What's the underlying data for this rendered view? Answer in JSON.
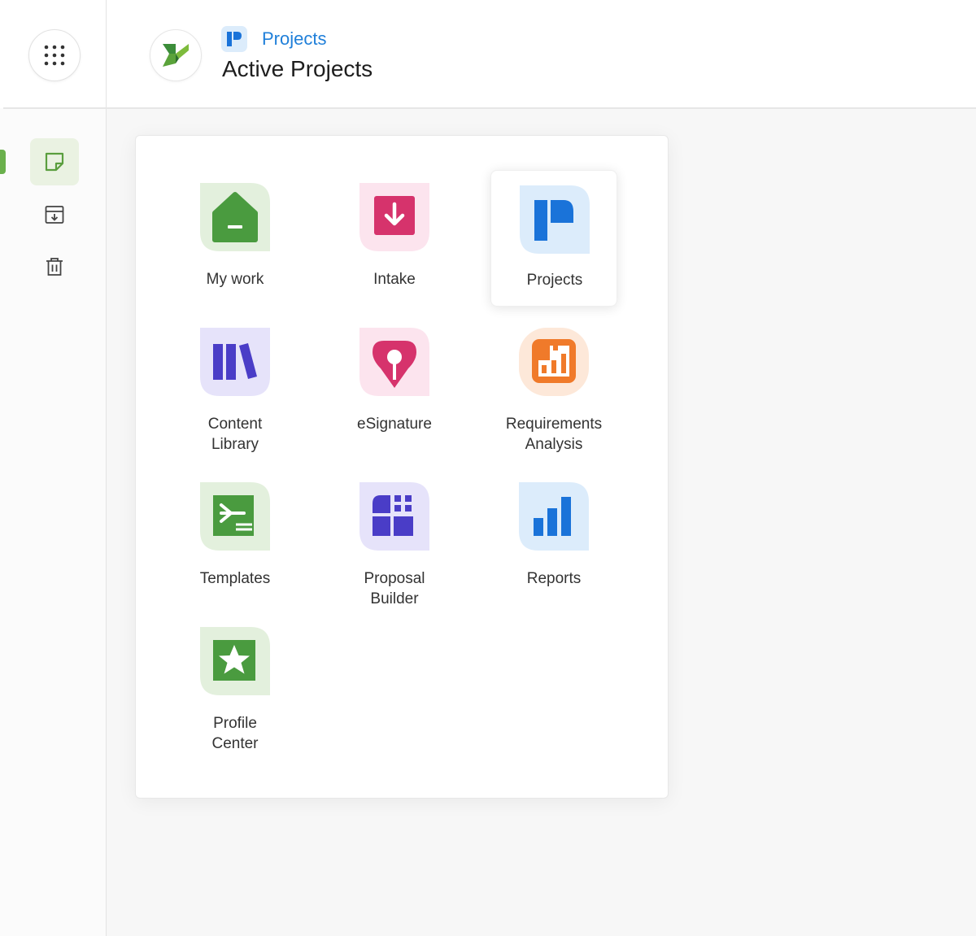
{
  "header": {
    "breadcrumb": "Projects",
    "title": "Active Projects"
  },
  "sidebar": {
    "items": [
      {
        "name": "notes",
        "icon": "note-icon",
        "active": true
      },
      {
        "name": "archive",
        "icon": "archive-download-icon",
        "active": false
      },
      {
        "name": "trash",
        "icon": "trash-icon",
        "active": false
      }
    ]
  },
  "app_launcher": {
    "apps": [
      {
        "label": "My work",
        "icon": "home-icon",
        "color": "#4a9b3f",
        "bg": "#e3f0dd",
        "selected": false
      },
      {
        "label": "Intake",
        "icon": "inbox-download-icon",
        "color": "#d6336c",
        "bg": "#fce4ee",
        "selected": false
      },
      {
        "label": "Projects",
        "icon": "projects-logo-icon",
        "color": "#1a73d9",
        "bg": "#dcecfb",
        "selected": true
      },
      {
        "label": "Content\nLibrary",
        "icon": "library-books-icon",
        "color": "#4a3dc7",
        "bg": "#e6e3fa",
        "selected": false
      },
      {
        "label": "eSignature",
        "icon": "signature-pin-icon",
        "color": "#d6336c",
        "bg": "#fce4ee",
        "selected": false
      },
      {
        "label": "Requirements\nAnalysis",
        "icon": "analysis-chart-icon",
        "color": "#f07a2a",
        "bg": "#fde8d9",
        "selected": false
      },
      {
        "label": "Templates",
        "icon": "template-arrow-icon",
        "color": "#4a9b3f",
        "bg": "#e3f0dd",
        "selected": false
      },
      {
        "label": "Proposal\nBuilder",
        "icon": "proposal-grid-icon",
        "color": "#4a3dc7",
        "bg": "#e6e3fa",
        "selected": false
      },
      {
        "label": "Reports",
        "icon": "bar-chart-icon",
        "color": "#1a73d9",
        "bg": "#dcecfb",
        "selected": false
      },
      {
        "label": "Profile\nCenter",
        "icon": "profile-star-icon",
        "color": "#4a9b3f",
        "bg": "#e3f0dd",
        "selected": false
      }
    ]
  }
}
